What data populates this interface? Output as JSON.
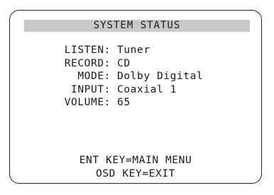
{
  "screen": {
    "title": "SYSTEM STATUS",
    "status": [
      {
        "label": "LISTEN:",
        "value": "Tuner"
      },
      {
        "label": "RECORD:",
        "value": "CD"
      },
      {
        "label": "MODE:",
        "value": "Dolby Digital"
      },
      {
        "label": "INPUT:",
        "value": "Coaxial 1"
      },
      {
        "label": "VOLUME:",
        "value": "65"
      }
    ],
    "footer": {
      "line1": "ENT KEY=MAIN MENU",
      "line2": "OSD KEY=EXIT"
    }
  },
  "colors": {
    "title_bar": "#c8c8c8",
    "border": "#222222",
    "text": "#1a1a1a"
  }
}
